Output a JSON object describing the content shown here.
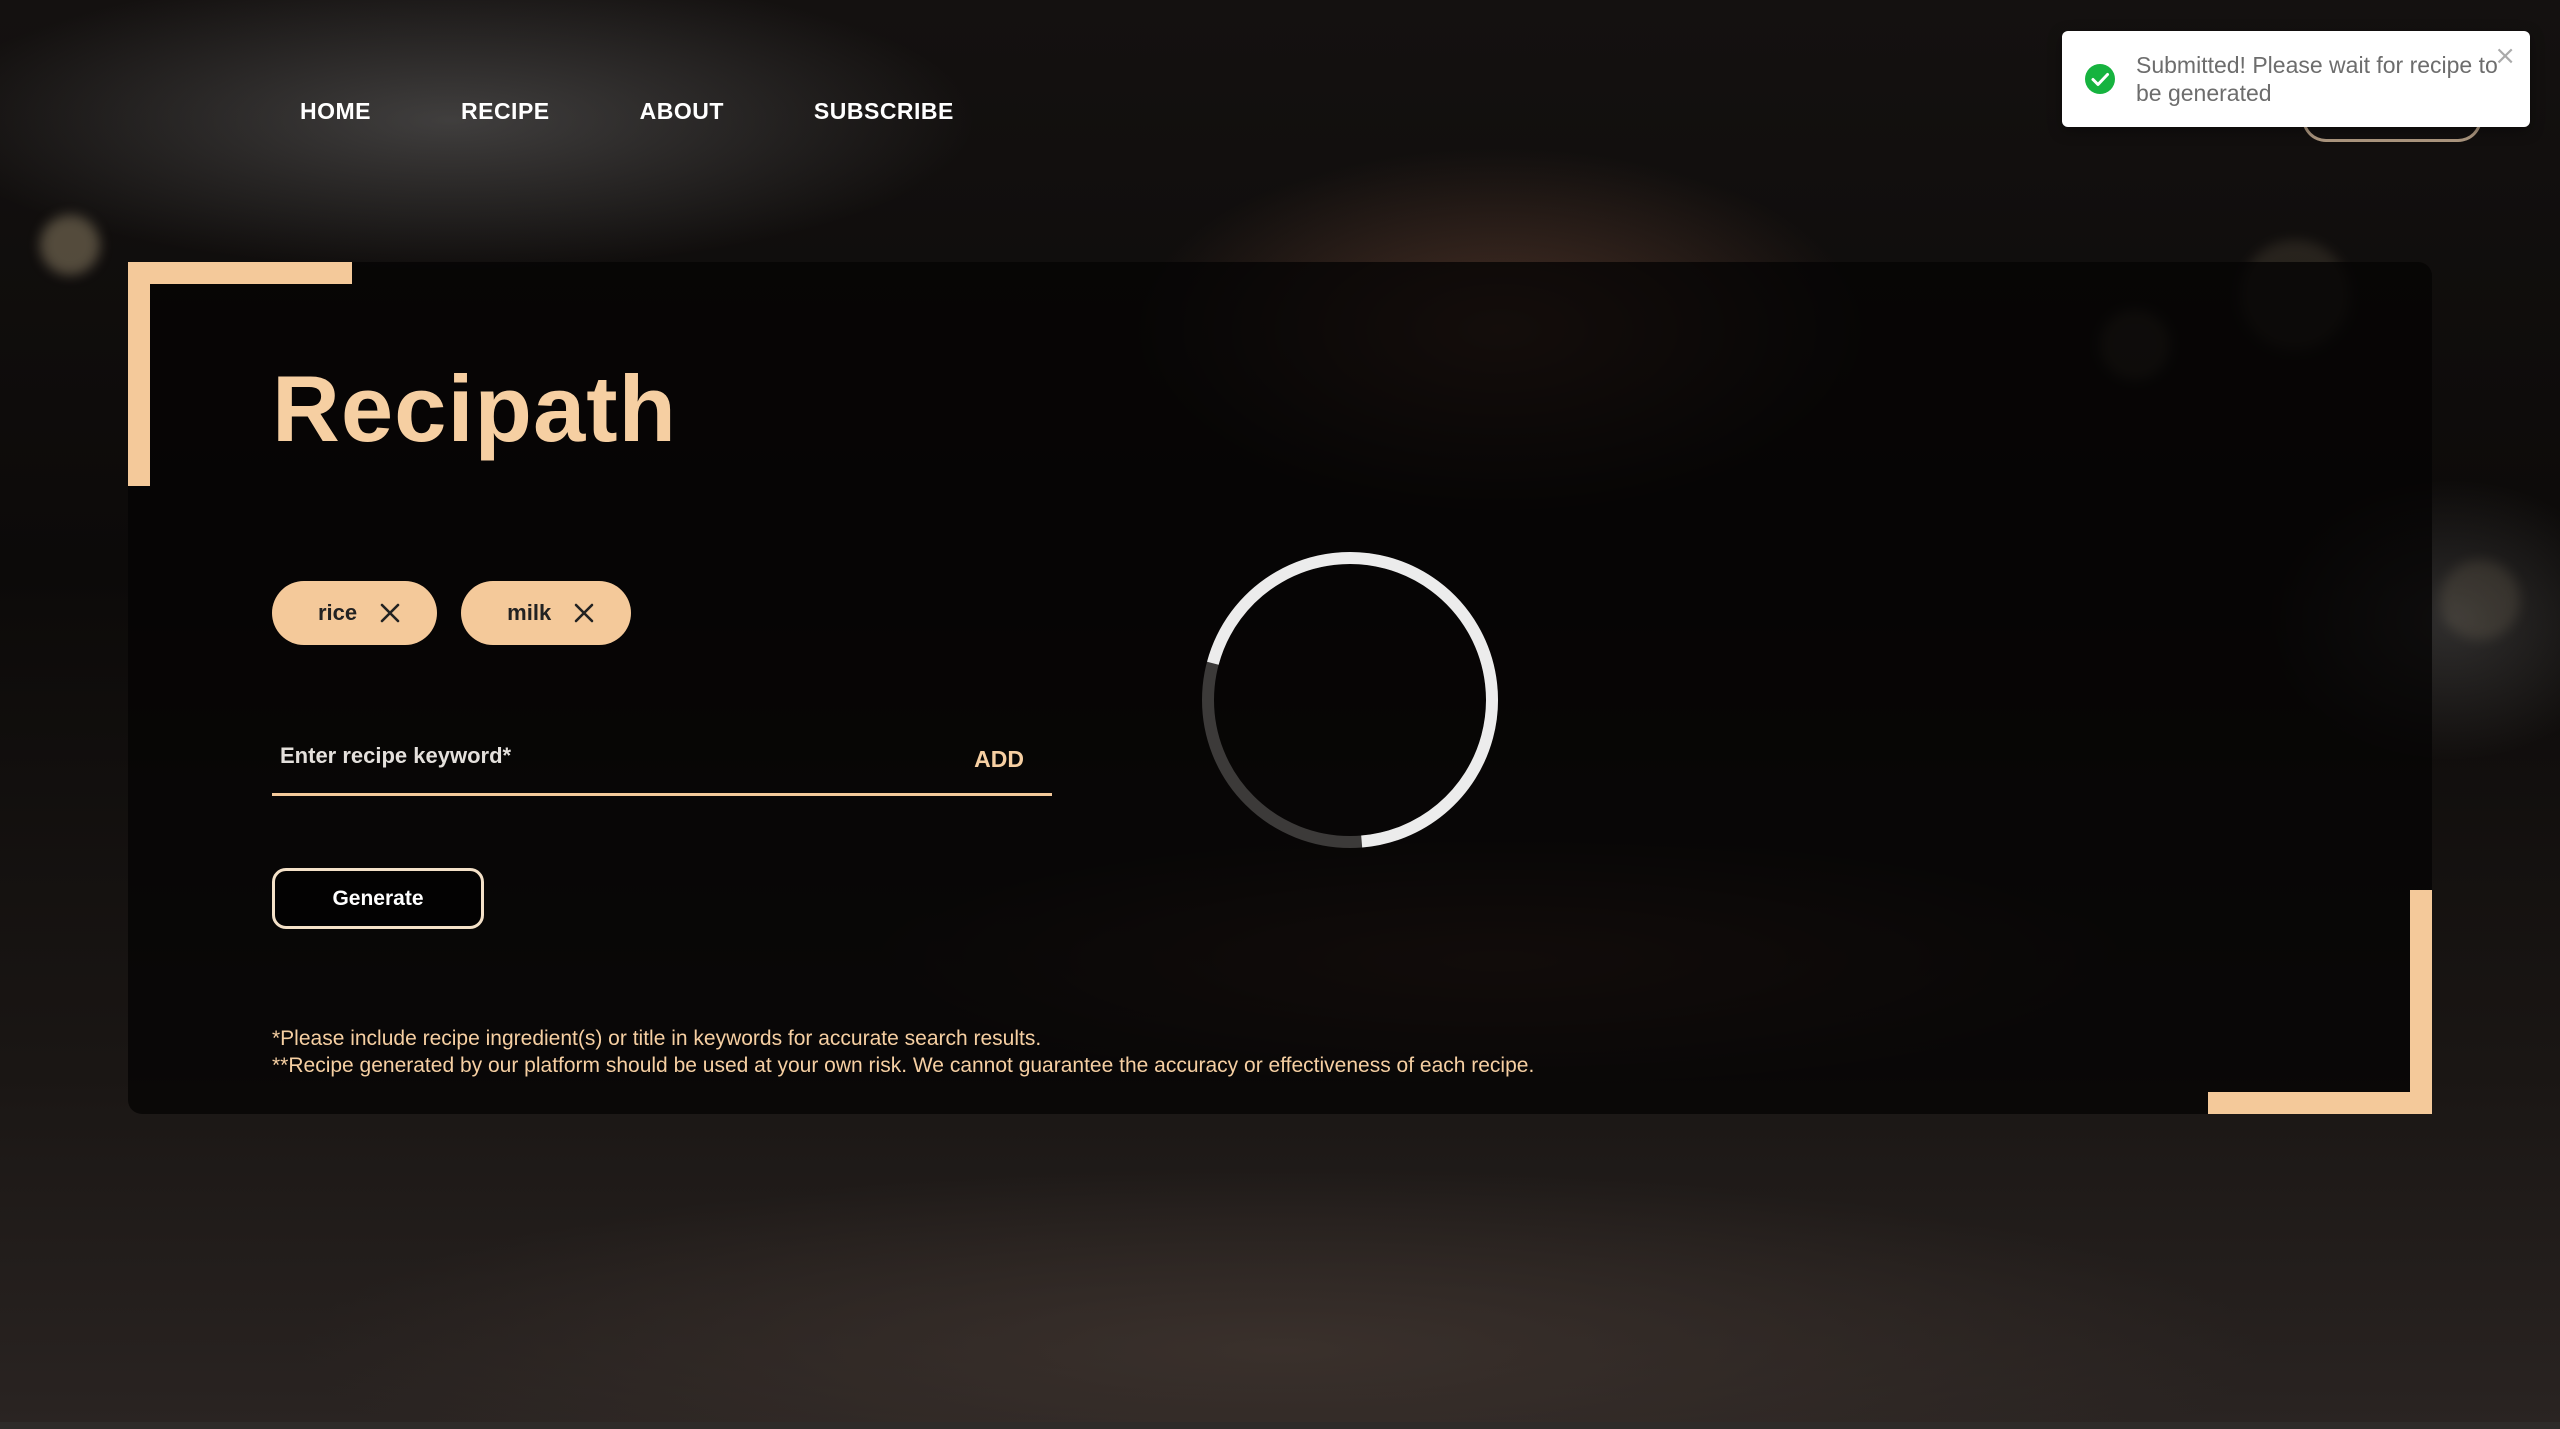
{
  "nav": {
    "items": [
      {
        "label": "HOME"
      },
      {
        "label": "RECIPE"
      },
      {
        "label": "ABOUT"
      },
      {
        "label": "SUBSCRIBE"
      }
    ]
  },
  "main": {
    "title": "Recipath",
    "chips": [
      {
        "label": "rice"
      },
      {
        "label": "milk"
      }
    ],
    "keyword_input": {
      "value": "",
      "placeholder": "Enter recipe keyword*"
    },
    "add_label": "ADD",
    "generate_label": "Generate",
    "disclaimer": [
      "*Please include recipe ingredient(s) or title in keywords for accurate search results.",
      "**Recipe generated by our platform should be used at your own risk. We cannot guarantee the accuracy or effectiveness of each recipe."
    ]
  },
  "toast": {
    "message": "Submitted! Please wait for recipe to be generated",
    "close_glyph": "×",
    "icon": "check-circle-icon",
    "status_color": "#16b33f"
  },
  "spinner": {
    "icon": "loading-spinner-icon"
  },
  "colors": {
    "accent": "#f4c99a",
    "title": "#f6cfa2"
  }
}
